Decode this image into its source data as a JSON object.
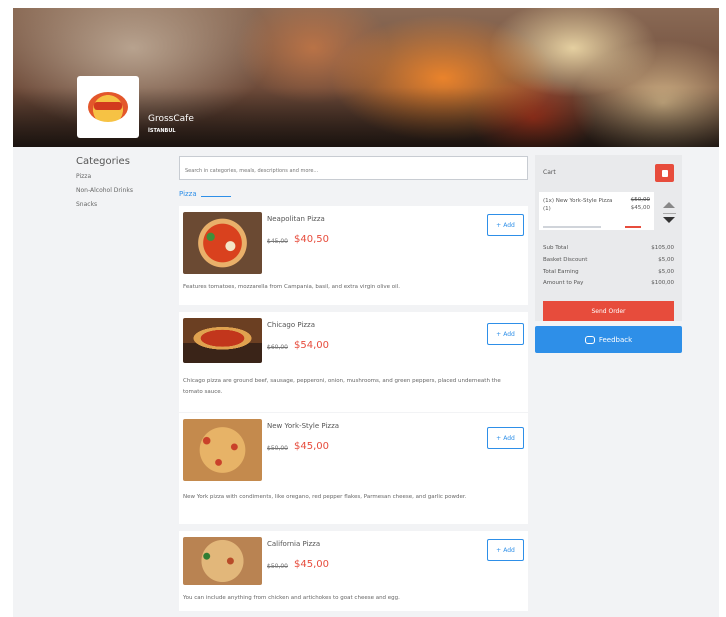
{
  "header": {
    "name": "GrossCafe",
    "city": "İSTANBUL"
  },
  "sidebar": {
    "title": "Categories",
    "items": [
      {
        "label": "Pizza"
      },
      {
        "label": "Non-Alcohol Drinks"
      },
      {
        "label": "Snacks"
      }
    ]
  },
  "search": {
    "placeholder": "Search in categories, meals, descriptions and more..."
  },
  "section": {
    "label": "Pizza"
  },
  "products": [
    {
      "name": "Neapolitan Pizza",
      "old_price": "$45,00",
      "price": "$40,50",
      "add_label": "Add",
      "description": "Features tomatoes, mozzarella from Campania, basil, and extra virgin olive oil."
    },
    {
      "name": "Chicago Pizza",
      "old_price": "$60,00",
      "price": "$54,00",
      "add_label": "Add",
      "description": "Chicago pizza are ground beef, sausage, pepperoni, onion, mushrooms, and green peppers, placed underneath the tomato sauce."
    },
    {
      "name": "New York-Style Pizza",
      "old_price": "$50,00",
      "price": "$45,00",
      "add_label": "Add",
      "description": "New York pizza with condiments, like oregano, red pepper flakes, Parmesan cheese, and garlic powder."
    },
    {
      "name": "California Pizza",
      "old_price": "$50,00",
      "price": "$45,00",
      "add_label": "Add",
      "description": "You can include anything from chicken and artichokes to goat cheese and egg."
    }
  ],
  "cart": {
    "title": "Cart",
    "item": {
      "name": "(1x) New York-Style Pizza (1)",
      "old_price": "$50,00",
      "price": "$45,00"
    },
    "summary": [
      {
        "label": "Sub Total",
        "value": "$105,00"
      },
      {
        "label": "Basket Discount",
        "value": "$5,00"
      },
      {
        "label": "Total Earning",
        "value": "$5,00"
      },
      {
        "label": "Amount to Pay",
        "value": "$100,00"
      }
    ],
    "send_label": "Send Order"
  },
  "feedback": {
    "label": "Feedback"
  },
  "colors": {
    "accent": "#2e8fe8",
    "danger": "#e74c3c"
  }
}
